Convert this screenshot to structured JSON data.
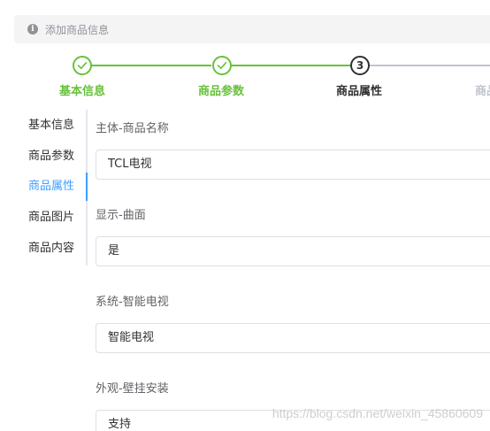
{
  "alert": {
    "icon": "info-icon",
    "text": "添加商品信息"
  },
  "steps": [
    {
      "title": "基本信息",
      "status": "finish",
      "icon": "check-icon"
    },
    {
      "title": "商品参数",
      "status": "finish",
      "icon": "check-icon"
    },
    {
      "title": "商品属性",
      "status": "process",
      "number": "3"
    },
    {
      "title": "商品",
      "status": "wait"
    }
  ],
  "tabs": [
    {
      "label": "基本信息",
      "active": false
    },
    {
      "label": "商品参数",
      "active": false
    },
    {
      "label": "商品属性",
      "active": true
    },
    {
      "label": "商品图片",
      "active": false
    },
    {
      "label": "商品内容",
      "active": false
    }
  ],
  "form": {
    "fields": [
      {
        "label": "主体-商品名称",
        "value": "TCL电视"
      },
      {
        "label": "显示-曲面",
        "value": "是"
      },
      {
        "label": "系统-智能电视",
        "value": "智能电视"
      },
      {
        "label": "外观-壁挂安装",
        "value": "支持"
      }
    ]
  },
  "watermark": "https://blog.csdn.net/weixin_45860609",
  "colors": {
    "success": "#67c23a",
    "primary": "#409eff",
    "wait": "#c0c4cc",
    "text": "#303133"
  }
}
